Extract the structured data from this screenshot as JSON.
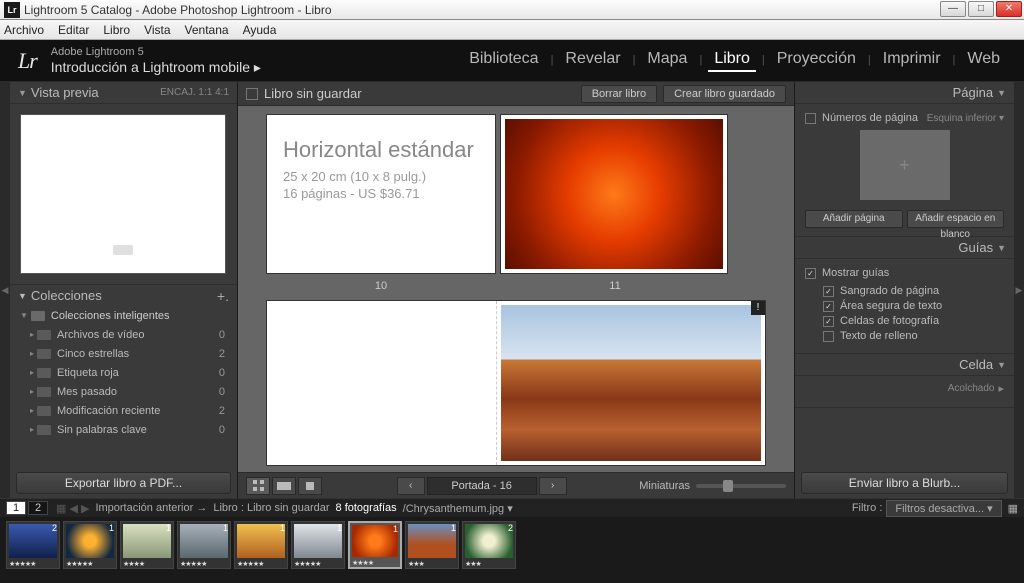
{
  "window": {
    "title": "Lightroom 5 Catalog - Adobe Photoshop Lightroom - Libro"
  },
  "osmenu": [
    "Archivo",
    "Editar",
    "Libro",
    "Vista",
    "Ventana",
    "Ayuda"
  ],
  "header": {
    "logo": "Lr",
    "sub1": "Adobe Lightroom 5",
    "sub2": "Introducción a Lightroom mobile  ▸",
    "modules": [
      "Biblioteca",
      "Revelar",
      "Mapa",
      "Libro",
      "Proyección",
      "Imprimir",
      "Web"
    ],
    "active_module": "Libro"
  },
  "left": {
    "preview": {
      "title": "Vista previa",
      "extra": "ENCAJ.   1:1   4:1"
    },
    "collections": {
      "title": "Colecciones",
      "group": "Colecciones inteligentes",
      "items": [
        {
          "name": "Archivos de vídeo",
          "count": 0
        },
        {
          "name": "Cinco estrellas",
          "count": 2
        },
        {
          "name": "Etiqueta roja",
          "count": 0
        },
        {
          "name": "Mes pasado",
          "count": 0
        },
        {
          "name": "Modificación reciente",
          "count": 2
        },
        {
          "name": "Sin palabras clave",
          "count": 0
        }
      ]
    },
    "export_btn": "Exportar libro a PDF..."
  },
  "center": {
    "topbar": {
      "title": "Libro sin guardar",
      "btn_clear": "Borrar libro",
      "btn_save": "Crear libro guardado"
    },
    "cover": {
      "t1": "Horizontal estándar",
      "t2": "25 x 20 cm (10 x 8 pulg.)",
      "t3": "16 páginas - US $36.71"
    },
    "pagenums": [
      "10",
      "11"
    ],
    "pager": {
      "label": "Portada - 16"
    },
    "thumb_label": "Miniaturas"
  },
  "right": {
    "page": {
      "title": "Página",
      "chk_numbers": "Números de página",
      "corner": "Esquina inferior ▾",
      "btn_add": "Añadir página",
      "btn_blank": "Añadir espacio en blanco"
    },
    "guides": {
      "title": "Guías",
      "show": "Mostrar guías",
      "items": [
        {
          "label": "Sangrado de página",
          "on": true
        },
        {
          "label": "Área segura de texto",
          "on": true
        },
        {
          "label": "Celdas de fotografía",
          "on": true
        },
        {
          "label": "Texto de relleno",
          "on": false
        }
      ]
    },
    "cell": {
      "title": "Celda",
      "padding": "Acolchado"
    },
    "send_btn": "Enviar libro a Blurb..."
  },
  "strip": {
    "nums": [
      "1",
      "2"
    ],
    "crumb1": "Importación anterior  →",
    "crumb2": "Libro : Libro sin guardar",
    "count": "8 fotografías",
    "filename": "/Chrysanthemum.jpg  ▾",
    "filter_label": "Filtro :",
    "filter_value": "Filtros desactiva... ▾",
    "thumbs": [
      {
        "badge": "2",
        "stars": "★★★★★",
        "cls": "c1"
      },
      {
        "badge": "1",
        "stars": "★★★★★",
        "cls": "c2"
      },
      {
        "badge": "1",
        "stars": "★★★★",
        "cls": "c3"
      },
      {
        "badge": "1",
        "stars": "★★★★★",
        "cls": "c4"
      },
      {
        "badge": "1",
        "stars": "★★★★★",
        "cls": "c5"
      },
      {
        "badge": "1",
        "stars": "★★★★★",
        "cls": "c6"
      },
      {
        "badge": "1",
        "stars": "★★★★",
        "cls": "c7",
        "sel": true
      },
      {
        "badge": "1",
        "stars": "★★★",
        "cls": "c8"
      },
      {
        "badge": "2",
        "stars": "★★★",
        "cls": "c9"
      }
    ]
  }
}
